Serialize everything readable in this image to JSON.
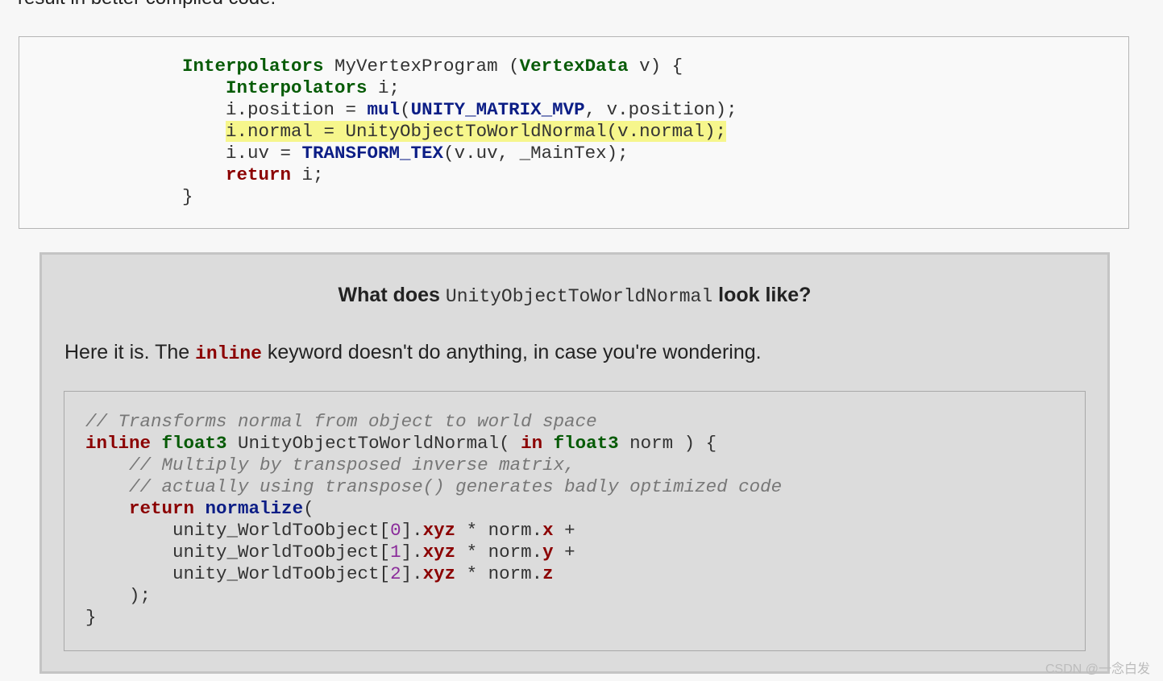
{
  "prev_text": "result in better compiled code.",
  "code1": [
    [
      {
        "t": "Interpolators",
        "c": "typ"
      },
      {
        "t": " MyVertexProgram ("
      },
      {
        "t": "VertexData",
        "c": "typ"
      },
      {
        "t": " v) {"
      }
    ],
    [
      {
        "t": "    "
      },
      {
        "t": "Interpolators",
        "c": "typ"
      },
      {
        "t": " i;"
      }
    ],
    [
      {
        "t": "    i.position = "
      },
      {
        "t": "mul",
        "c": "fn"
      },
      {
        "t": "("
      },
      {
        "t": "UNITY_MATRIX_MVP",
        "c": "fn"
      },
      {
        "t": ", v.position);"
      }
    ],
    [
      {
        "t": "    "
      },
      {
        "t": "i.normal = UnityObjectToWorldNormal(v.normal);",
        "c": "hl"
      }
    ],
    [
      {
        "t": "    i.uv = "
      },
      {
        "t": "TRANSFORM_TEX",
        "c": "fn"
      },
      {
        "t": "(v.uv, _MainTex);"
      }
    ],
    [
      {
        "t": "    "
      },
      {
        "t": "return",
        "c": "kw"
      },
      {
        "t": " i;"
      }
    ],
    [
      {
        "t": "}"
      }
    ]
  ],
  "note": {
    "title_prefix": "What does",
    "title_code": "UnityObjectToWorldNormal",
    "title_suffix": "look like?",
    "text_prefix": "Here it is. The",
    "text_keyword": "inline",
    "text_suffix": "keyword doesn't do anything, in case you're wondering."
  },
  "code2": [
    [
      {
        "t": "// Transforms normal from object to world space",
        "c": "cm"
      }
    ],
    [
      {
        "t": "inline",
        "c": "kw"
      },
      {
        "t": " "
      },
      {
        "t": "float3",
        "c": "typ"
      },
      {
        "t": " UnityObjectToWorldNormal( "
      },
      {
        "t": "in",
        "c": "kw"
      },
      {
        "t": " "
      },
      {
        "t": "float3",
        "c": "typ"
      },
      {
        "t": " norm ) {"
      }
    ],
    [
      {
        "t": "    "
      },
      {
        "t": "// Multiply by transposed inverse matrix,",
        "c": "cm"
      }
    ],
    [
      {
        "t": "    "
      },
      {
        "t": "// actually using transpose() generates badly optimized code",
        "c": "cm"
      }
    ],
    [
      {
        "t": "    "
      },
      {
        "t": "return",
        "c": "kw"
      },
      {
        "t": " "
      },
      {
        "t": "normalize",
        "c": "fn"
      },
      {
        "t": "("
      }
    ],
    [
      {
        "t": "        unity_WorldToObject["
      },
      {
        "t": "0",
        "c": "num"
      },
      {
        "t": "]."
      },
      {
        "t": "xyz",
        "c": "mem"
      },
      {
        "t": " * norm."
      },
      {
        "t": "x",
        "c": "mem"
      },
      {
        "t": " +"
      }
    ],
    [
      {
        "t": "        unity_WorldToObject["
      },
      {
        "t": "1",
        "c": "num"
      },
      {
        "t": "]."
      },
      {
        "t": "xyz",
        "c": "mem"
      },
      {
        "t": " * norm."
      },
      {
        "t": "y",
        "c": "mem"
      },
      {
        "t": " +"
      }
    ],
    [
      {
        "t": "        unity_WorldToObject["
      },
      {
        "t": "2",
        "c": "num"
      },
      {
        "t": "]."
      },
      {
        "t": "xyz",
        "c": "mem"
      },
      {
        "t": " * norm."
      },
      {
        "t": "z",
        "c": "mem"
      }
    ],
    [
      {
        "t": "    );"
      }
    ],
    [
      {
        "t": "}"
      }
    ]
  ],
  "watermark": "CSDN @一念白发"
}
